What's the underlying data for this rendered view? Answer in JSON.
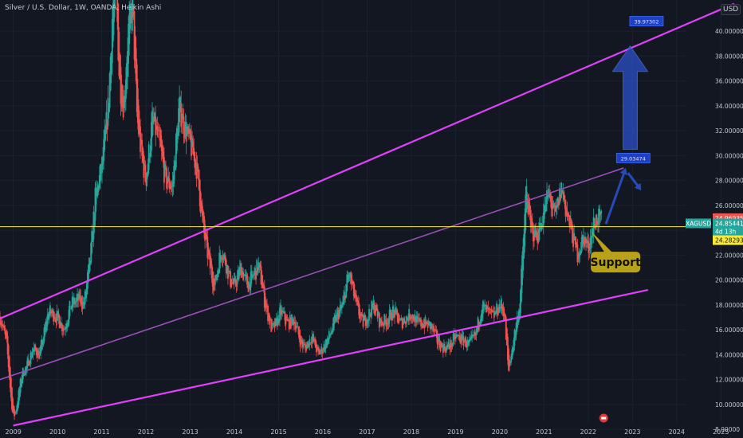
{
  "header": {
    "symbol_title": "Silver / U.S. Dollar, 1W, OANDA, Heikin Ashi",
    "currency": "USD"
  },
  "colors": {
    "background": "#131722",
    "up_candle": "#26a69a",
    "down_candle": "#ef5350",
    "trendline": "#e040fb",
    "mid_trendline": "#9c4fb8",
    "horizontal_line": "#f5e93a",
    "arrow": "#2b50c8",
    "support_box": "#b8a21a"
  },
  "chart_data": {
    "type": "candlestick",
    "title": "Silver / U.S. Dollar, 1W, OANDA, Heikin Ashi",
    "xlabel": "",
    "ylabel": "",
    "x_range": [
      2008.7,
      2025.5
    ],
    "ylim": [
      7.3,
      42.5
    ],
    "x_ticks": [
      "2009",
      "2010",
      "2011",
      "2012",
      "2013",
      "2014",
      "2015",
      "2016",
      "2017",
      "2018",
      "2019",
      "2020",
      "2021",
      "2022",
      "2023",
      "2024",
      "2025"
    ],
    "y_ticks": [
      "8.00000",
      "10.00000",
      "12.00000",
      "14.00000",
      "16.00000",
      "18.00000",
      "20.00000",
      "22.00000",
      "24.00000",
      "26.00000",
      "28.00000",
      "30.00000",
      "32.00000",
      "34.00000",
      "36.00000",
      "38.00000",
      "40.00000"
    ],
    "price_series": [
      [
        2008.7,
        17.0
      ],
      [
        2008.85,
        15.0
      ],
      [
        2008.95,
        10.5
      ],
      [
        2009.0,
        9.0
      ],
      [
        2009.05,
        9.3
      ],
      [
        2009.2,
        12.5
      ],
      [
        2009.3,
        13.0
      ],
      [
        2009.45,
        14.5
      ],
      [
        2009.6,
        14.0
      ],
      [
        2009.8,
        17.5
      ],
      [
        2010.0,
        17.0
      ],
      [
        2010.15,
        16.0
      ],
      [
        2010.3,
        18.0
      ],
      [
        2010.5,
        18.5
      ],
      [
        2010.6,
        18.0
      ],
      [
        2010.75,
        22.0
      ],
      [
        2010.85,
        26.5
      ],
      [
        2011.0,
        29.0
      ],
      [
        2011.15,
        34.0
      ],
      [
        2011.25,
        42.0
      ],
      [
        2011.32,
        44.0
      ],
      [
        2011.4,
        36.0
      ],
      [
        2011.5,
        34.0
      ],
      [
        2011.6,
        40.0
      ],
      [
        2011.7,
        42.0
      ],
      [
        2011.8,
        33.0
      ],
      [
        2011.9,
        30.0
      ],
      [
        2012.0,
        28.0
      ],
      [
        2012.15,
        33.0
      ],
      [
        2012.3,
        31.0
      ],
      [
        2012.45,
        28.0
      ],
      [
        2012.6,
        27.5
      ],
      [
        2012.75,
        34.0
      ],
      [
        2012.9,
        32.0
      ],
      [
        2013.0,
        31.0
      ],
      [
        2013.15,
        29.0
      ],
      [
        2013.3,
        24.0
      ],
      [
        2013.45,
        21.0
      ],
      [
        2013.55,
        19.5
      ],
      [
        2013.7,
        22.5
      ],
      [
        2013.8,
        21.5
      ],
      [
        2013.9,
        20.0
      ],
      [
        2014.0,
        19.5
      ],
      [
        2014.15,
        21.0
      ],
      [
        2014.3,
        19.5
      ],
      [
        2014.45,
        20.5
      ],
      [
        2014.55,
        21.2
      ],
      [
        2014.7,
        18.0
      ],
      [
        2014.85,
        16.0
      ],
      [
        2014.95,
        16.5
      ],
      [
        2015.05,
        17.5
      ],
      [
        2015.2,
        16.5
      ],
      [
        2015.35,
        16.8
      ],
      [
        2015.5,
        15.0
      ],
      [
        2015.6,
        14.5
      ],
      [
        2015.75,
        15.5
      ],
      [
        2015.9,
        14.0
      ],
      [
        2016.0,
        14.5
      ],
      [
        2016.15,
        15.5
      ],
      [
        2016.3,
        17.0
      ],
      [
        2016.45,
        18.0
      ],
      [
        2016.55,
        20.0
      ],
      [
        2016.6,
        20.5
      ],
      [
        2016.75,
        18.0
      ],
      [
        2016.9,
        16.5
      ],
      [
        2017.0,
        17.0
      ],
      [
        2017.15,
        18.0
      ],
      [
        2017.3,
        16.5
      ],
      [
        2017.45,
        16.8
      ],
      [
        2017.6,
        17.5
      ],
      [
        2017.75,
        16.5
      ],
      [
        2017.9,
        17.0
      ],
      [
        2018.0,
        17.3
      ],
      [
        2018.15,
        16.5
      ],
      [
        2018.3,
        16.5
      ],
      [
        2018.45,
        16.3
      ],
      [
        2018.6,
        15.0
      ],
      [
        2018.75,
        14.5
      ],
      [
        2018.9,
        14.8
      ],
      [
        2019.0,
        15.5
      ],
      [
        2019.15,
        15.2
      ],
      [
        2019.3,
        14.8
      ],
      [
        2019.45,
        15.5
      ],
      [
        2019.6,
        18.0
      ],
      [
        2019.7,
        17.5
      ],
      [
        2019.85,
        17.0
      ],
      [
        2020.0,
        18.0
      ],
      [
        2020.1,
        17.5
      ],
      [
        2020.2,
        12.5
      ],
      [
        2020.3,
        15.0
      ],
      [
        2020.45,
        18.0
      ],
      [
        2020.55,
        24.0
      ],
      [
        2020.6,
        27.5
      ],
      [
        2020.7,
        24.0
      ],
      [
        2020.85,
        23.5
      ],
      [
        2021.0,
        25.5
      ],
      [
        2021.1,
        27.0
      ],
      [
        2021.25,
        25.0
      ],
      [
        2021.4,
        27.5
      ],
      [
        2021.5,
        25.5
      ],
      [
        2021.65,
        23.5
      ],
      [
        2021.75,
        22.0
      ],
      [
        2021.9,
        23.5
      ],
      [
        2022.0,
        22.5
      ],
      [
        2022.12,
        24.5
      ],
      [
        2022.2,
        25.0
      ],
      [
        2022.3,
        24.8
      ]
    ],
    "trendlines": [
      {
        "name": "upper channel",
        "points": [
          [
            2008.7,
            16.9
          ],
          [
            2025.3,
            42.2
          ]
        ]
      },
      {
        "name": "middle channel",
        "points": [
          [
            2008.7,
            12.0
          ],
          [
            2022.8,
            29.0
          ]
        ]
      },
      {
        "name": "lower channel",
        "points": [
          [
            2009.0,
            8.3
          ],
          [
            2023.35,
            19.2
          ]
        ]
      }
    ],
    "horizontal_line": 24.28293,
    "projection_arrows": [
      {
        "from": [
          2022.4,
          24.5
        ],
        "to": [
          2022.85,
          29.0
        ]
      },
      {
        "from": [
          2022.95,
          30.5
        ],
        "to": [
          2022.95,
          38.8
        ]
      },
      {
        "from": [
          2022.9,
          28.6
        ],
        "to": [
          2023.2,
          27.2
        ]
      }
    ],
    "price_labels": [
      {
        "value": "24.96935",
        "price": 24.96935,
        "bg": "#ef5350",
        "fg": "#ffffff"
      },
      {
        "value": "24.85441",
        "price": 24.55,
        "bg": "#26a69a",
        "fg": "#ffffff",
        "symbol": "XAGUSD"
      },
      {
        "value": "4d 13h",
        "price": 23.9,
        "bg": "#26a69a",
        "fg": "#ffffff"
      },
      {
        "value": "24.28293",
        "price": 23.2,
        "bg": "#f5e93a",
        "fg": "#111111"
      }
    ],
    "callouts": [
      {
        "text": "39.97302",
        "x": 2023.3,
        "price": 40.8
      },
      {
        "text": "29.03474",
        "x": 2023.0,
        "price": 29.8
      }
    ],
    "annotation": {
      "text": "Support",
      "x": 2022.6,
      "price": 21.5
    }
  }
}
